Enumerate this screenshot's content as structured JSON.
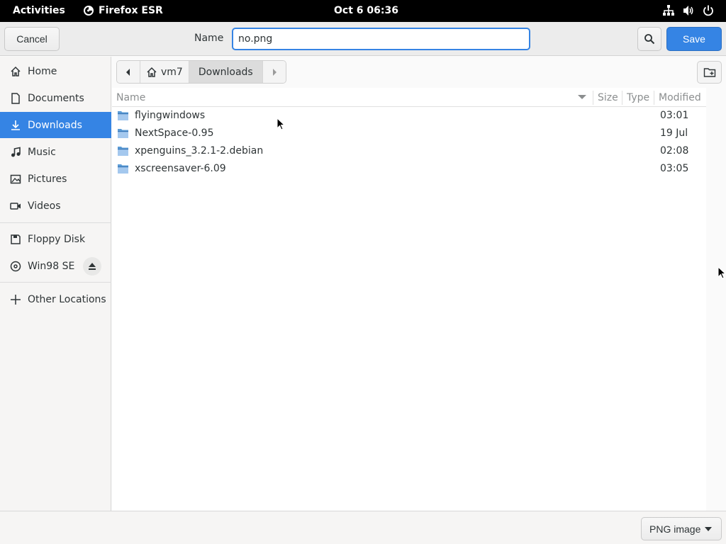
{
  "topbar": {
    "activities": "Activities",
    "app_name": "Firefox ESR",
    "clock": "Oct 6  06:36",
    "tray_icons": [
      "network-icon",
      "volume-icon",
      "power-icon"
    ]
  },
  "header": {
    "cancel_label": "Cancel",
    "name_label": "Name",
    "name_value": "no.png",
    "save_label": "Save"
  },
  "sidebar": {
    "items": [
      {
        "label": "Home",
        "icon": "home-icon"
      },
      {
        "label": "Documents",
        "icon": "document-icon"
      },
      {
        "label": "Downloads",
        "icon": "download-icon",
        "active": true
      },
      {
        "label": "Music",
        "icon": "music-icon"
      },
      {
        "label": "Pictures",
        "icon": "picture-icon"
      },
      {
        "label": "Videos",
        "icon": "video-icon"
      },
      {
        "label": "Floppy Disk",
        "icon": "floppy-icon"
      },
      {
        "label": "Win98 SE",
        "icon": "disc-icon"
      },
      {
        "label": "Other Locations",
        "icon": "plus-icon"
      }
    ]
  },
  "pathbar": {
    "home_segment": "vm7",
    "current_segment": "Downloads"
  },
  "columns": {
    "name": "Name",
    "size": "Size",
    "type": "Type",
    "modified": "Modified"
  },
  "files": [
    {
      "name": "flyingwindows",
      "modified": "03:01"
    },
    {
      "name": "NextSpace-0.95",
      "modified": "19 Jul"
    },
    {
      "name": "xpenguins_3.2.1-2.debian",
      "modified": "02:08"
    },
    {
      "name": "xscreensaver-6.09",
      "modified": "03:05"
    }
  ],
  "footer": {
    "filter_label": "PNG image"
  },
  "colors": {
    "accent": "#3584e4",
    "folder": "#5b9bd5"
  }
}
